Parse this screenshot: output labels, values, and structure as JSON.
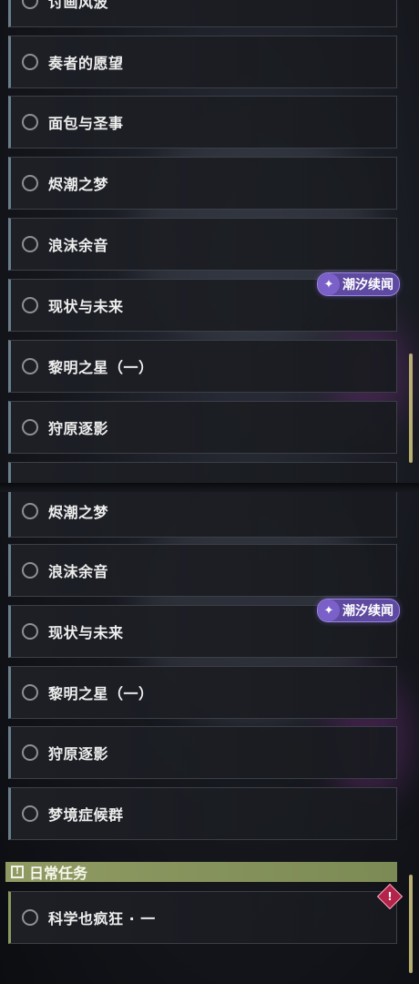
{
  "top_list": {
    "partial_label": "讨画风波",
    "items": [
      {
        "label": "奏者的愿望"
      },
      {
        "label": "面包与圣事"
      },
      {
        "label": "烬潮之梦"
      },
      {
        "label": "浪沫余音"
      },
      {
        "label": "现状与未来"
      },
      {
        "label": "黎明之星（一）"
      },
      {
        "label": "狩原逐影"
      }
    ],
    "tag": {
      "icon": "tidal-sequel-icon",
      "label": "潮汐续闻"
    }
  },
  "bottom_list": {
    "items": [
      {
        "label": "烬潮之梦"
      },
      {
        "label": "浪沫余音"
      },
      {
        "label": "现状与未来"
      },
      {
        "label": "黎明之星（一）"
      },
      {
        "label": "狩原逐影"
      },
      {
        "label": "梦境症候群"
      }
    ],
    "tag": {
      "icon": "tidal-sequel-icon",
      "label": "潮汐续闻"
    },
    "daily_section": {
      "title": "日常任务",
      "icon": "exclamation-icon",
      "items": [
        {
          "label": "科学也疯狂 · 一"
        }
      ],
      "alert_icon": "exclamation-diamond-icon"
    }
  },
  "colors": {
    "accent_story": "#6a7f8c",
    "accent_daily": "#8f9b62",
    "tag_bg": "#5e4aa0",
    "scrollbar": "#b8ad72",
    "alert": "#b3234a"
  }
}
